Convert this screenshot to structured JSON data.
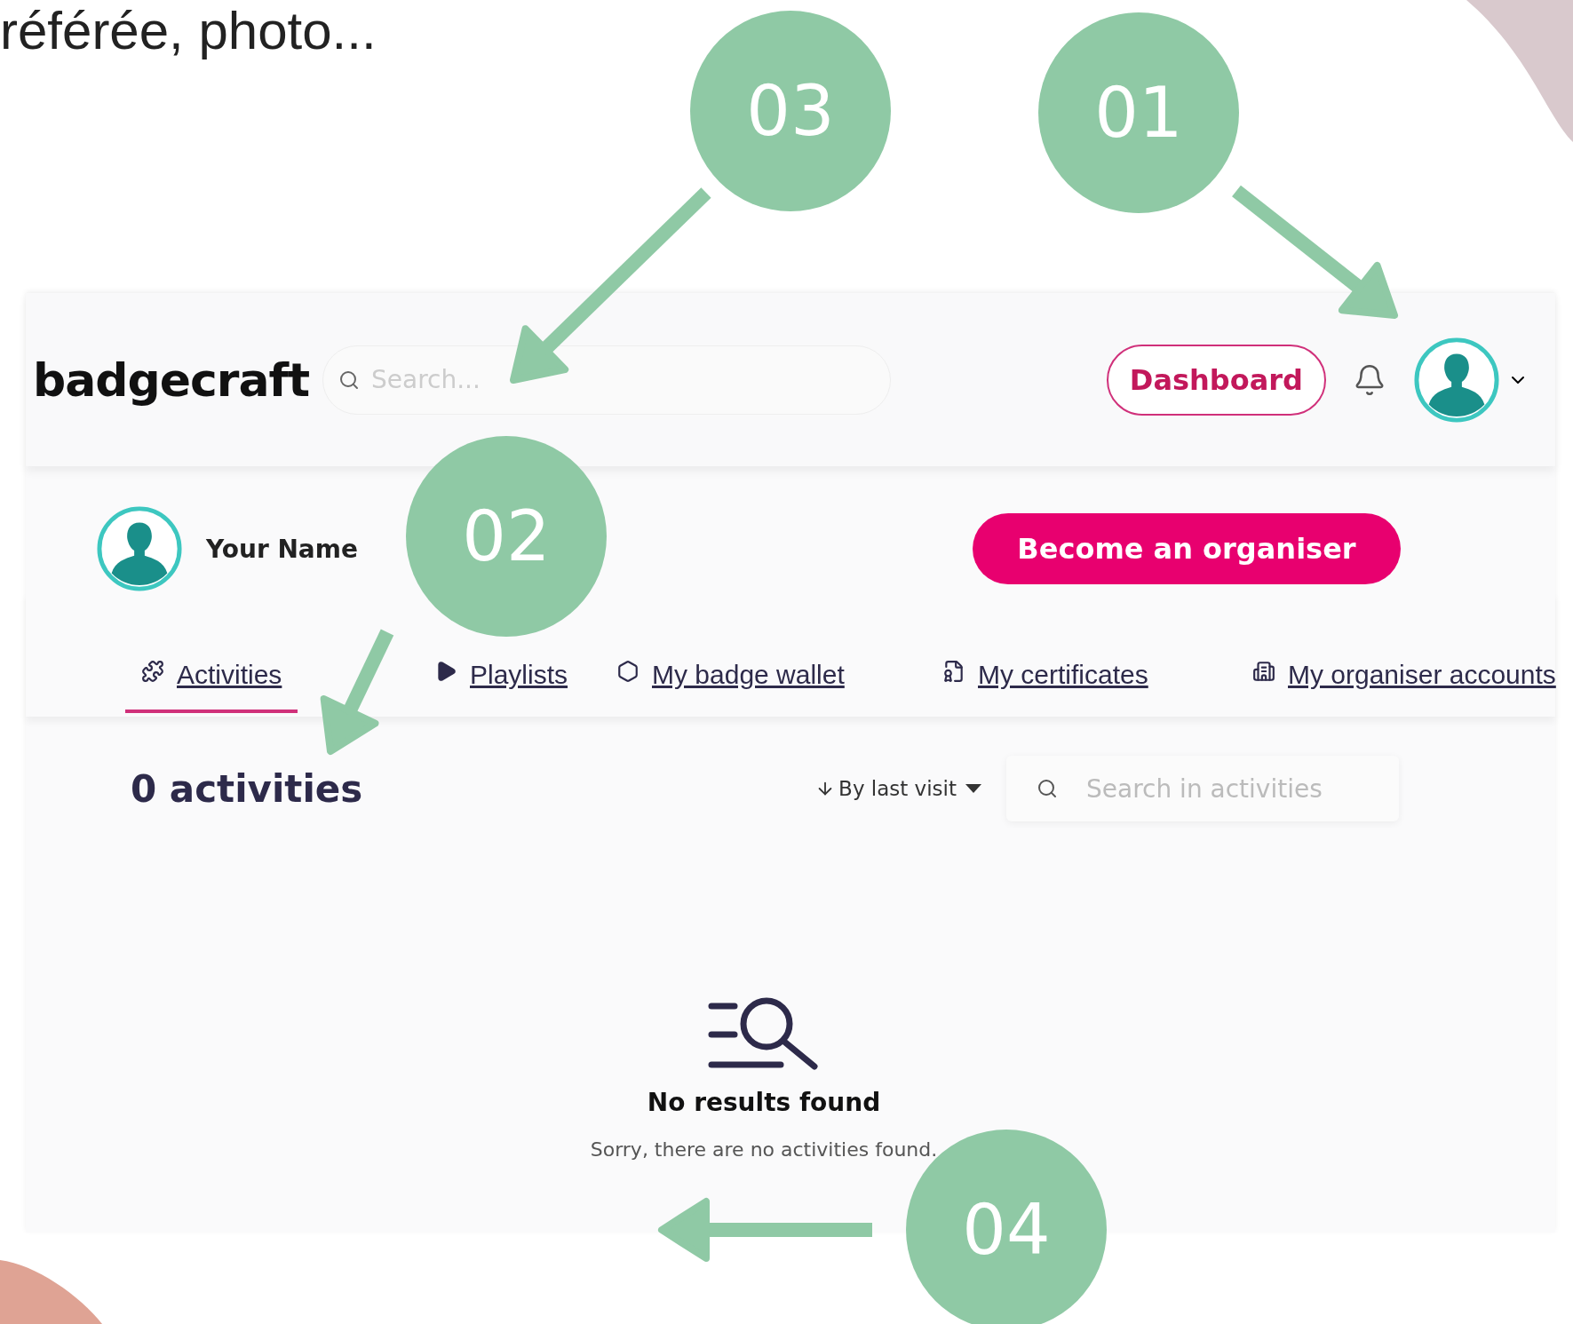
{
  "caption": "référée, photo...",
  "header": {
    "logo": "badgecraft",
    "search": {
      "placeholder": "Search..."
    },
    "dashboard_button": "Dashboard"
  },
  "profile": {
    "name": "Your Name",
    "organiser_button": "Become an organiser"
  },
  "tabs": [
    {
      "label": "Activities",
      "selected": true,
      "kind": "puzzle"
    },
    {
      "label": "Playlists",
      "selected": false,
      "kind": "play"
    },
    {
      "label": "My badge wallet",
      "selected": false,
      "kind": "badge"
    },
    {
      "label": "My certificates",
      "selected": false,
      "kind": "certificate"
    },
    {
      "label": "My organiser accounts",
      "selected": false,
      "kind": "building"
    }
  ],
  "content": {
    "count": "0 activities",
    "sort": "By last visit",
    "search": {
      "placeholder": "Search in activities"
    },
    "empty_title": "No results found",
    "empty_text": "Sorry, there are no activities found."
  },
  "annotations": [
    {
      "label": "03"
    },
    {
      "label": "01"
    },
    {
      "label": "02"
    },
    {
      "label": "04"
    }
  ]
}
